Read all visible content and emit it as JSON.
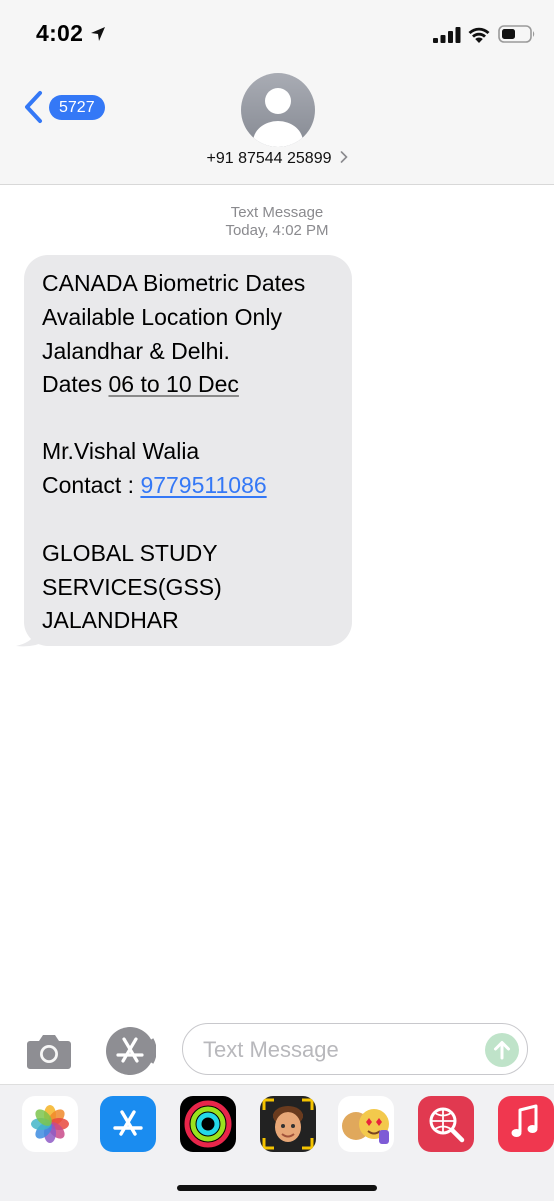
{
  "status_bar": {
    "time": "4:02"
  },
  "header": {
    "back_badge": "5727",
    "contact": "+91 87544 25899"
  },
  "thread": {
    "service_label": "Text Message",
    "timestamp": "Today, 4:02 PM"
  },
  "message": {
    "line1": "CANADA Biometric Dates",
    "line2": "Available Location Only",
    "line3": "Jalandhar & Delhi.",
    "line4_prefix": "Dates ",
    "line4_link": "06 to 10 Dec",
    "line6": "Mr.Vishal Walia",
    "line7_prefix": "Contact : ",
    "line7_link": "9779511086",
    "line9": "GLOBAL STUDY",
    "line10": "SERVICES(GSS)",
    "line11": "JALANDHAR"
  },
  "composer": {
    "placeholder": "Text Message"
  },
  "app_drawer": {
    "apps": [
      "photos-icon",
      "app-store-icon",
      "activity-icon",
      "memoji-icon",
      "animoji-stickers-icon",
      "web-search-icon",
      "music-icon"
    ]
  },
  "colors": {
    "accent": "#3478f6",
    "bubble": "#e9e9eb",
    "timestamp": "#8a8a8e",
    "send_disabled": "#bfe3c9"
  }
}
